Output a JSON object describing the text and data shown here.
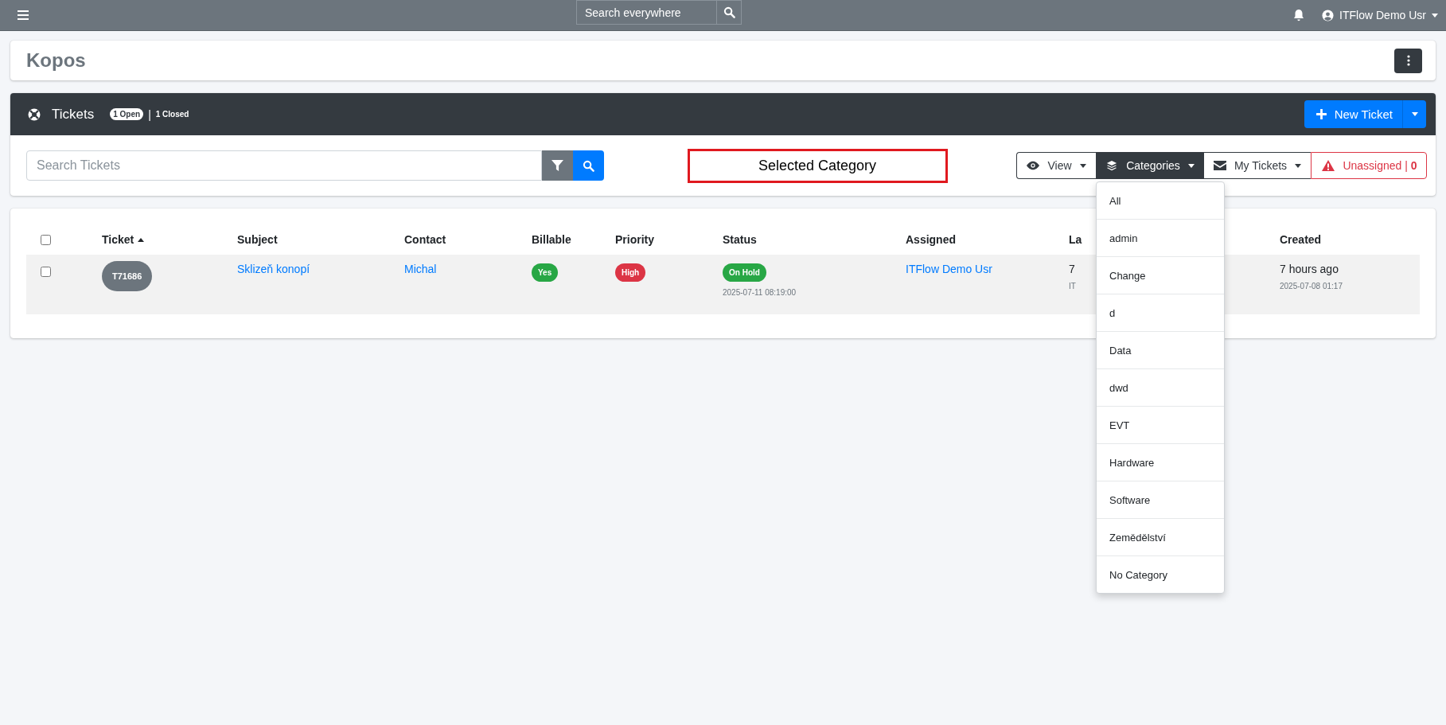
{
  "topbar": {
    "search_placeholder": "Search everywhere",
    "user": "ITFlow Demo Usr"
  },
  "client": {
    "name": "Kopos"
  },
  "tickets_panel": {
    "title": "Tickets",
    "open_count": "1 Open",
    "separator": "|",
    "closed_count": "1 Closed",
    "new_button": "New Ticket"
  },
  "filter": {
    "search_placeholder": "Search Tickets",
    "annotation": "Selected Category",
    "buttons": [
      {
        "label": "View",
        "kind": "view",
        "selected": false
      },
      {
        "label": "Categories",
        "kind": "categories",
        "selected": true
      },
      {
        "label": "My Tickets",
        "kind": "mine",
        "selected": false
      }
    ],
    "unassigned": "Unassigned | **0**"
  },
  "categories_menu": [
    {
      "label": "All"
    },
    {
      "label": "admin"
    },
    {
      "label": "Change"
    },
    {
      "label": "d"
    },
    {
      "label": "Data"
    },
    {
      "label": "dwd"
    },
    {
      "label": "EVT"
    },
    {
      "label": "Hardware"
    },
    {
      "label": "Software"
    },
    {
      "label": "Zemědělství"
    },
    {
      "label": "No Category"
    }
  ],
  "table": {
    "select_all_checked": false,
    "columns": [
      {
        "label": "Ticket",
        "sorted": true
      },
      {
        "label": "Subject",
        "sorted": false
      },
      {
        "label": "Contact",
        "sorted": false
      },
      {
        "label": "Billable",
        "sorted": false
      },
      {
        "label": "Priority",
        "sorted": false
      },
      {
        "label": "Status",
        "sorted": false
      },
      {
        "label": "Assigned",
        "sorted": false
      },
      {
        "label": "La",
        "sorted": false
      },
      {
        "label": "Created",
        "sorted": false
      }
    ],
    "rows": [
      {
        "checked": false,
        "ticket": "T71686",
        "subject": "Sklizeň konopí",
        "contact": "Michal",
        "billable": {
          "label": "Yes",
          "color": "#28a745"
        },
        "priority": {
          "label": "High",
          "color": "#dc3545"
        },
        "status": {
          "label": "On Hold",
          "color": "#28a745"
        },
        "status_date": "2025-07-11 08:19:00",
        "assigned": "ITFlow Demo Usr",
        "last_response": "7",
        "last_response_by": "IT",
        "created": "7 hours ago",
        "created_date": "2025-07-08 01:17"
      }
    ]
  }
}
